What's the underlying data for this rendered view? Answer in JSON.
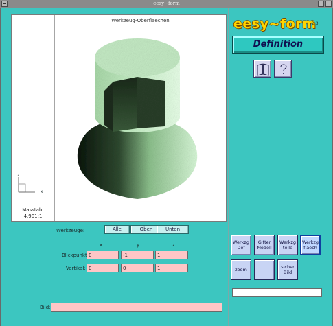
{
  "window": {
    "title": "eesy~form"
  },
  "viewport": {
    "caption": "Werkzeug-Oberflaechen",
    "axis_z": "z",
    "axis_x": "x",
    "scale_label": "Masstab:",
    "scale_value": "4.901:1"
  },
  "tools_row": {
    "label": "Werkzeuge:",
    "buttons": [
      "Alle",
      "Oben",
      "Unten"
    ]
  },
  "coords": {
    "headers": [
      "x",
      "y",
      "z"
    ],
    "blickpunkt": {
      "label": "Blickpunkt:",
      "values": [
        "0",
        "-1",
        "1"
      ]
    },
    "vertikal": {
      "label": "Vertikal:",
      "values": [
        "0",
        "0",
        "1"
      ]
    }
  },
  "bild": {
    "label": "Bild:",
    "value": ""
  },
  "brand": {
    "name": "eesy~form",
    "version": "2.3"
  },
  "mode": {
    "title": "Definition"
  },
  "help_icons": [
    "book-icon",
    "question-icon"
  ],
  "toolbar": {
    "items": [
      {
        "label_1": "Werkzg",
        "label_2": "Def"
      },
      {
        "label_1": "Gitter",
        "label_2": "Modell"
      },
      {
        "label_1": "Werkzg",
        "label_2": "teile"
      },
      {
        "label_1": "Werkzg",
        "label_2": "flaech"
      },
      {
        "label_1": "zoom",
        "label_2": ""
      },
      {
        "label_1": "",
        "label_2": ""
      },
      {
        "label_1": "sicher",
        "label_2": "Bild"
      }
    ]
  },
  "status": {
    "value": ""
  },
  "colors": {
    "background": "#3cc6c0",
    "brand": "#ffd400",
    "field": "#ffc6c6"
  }
}
